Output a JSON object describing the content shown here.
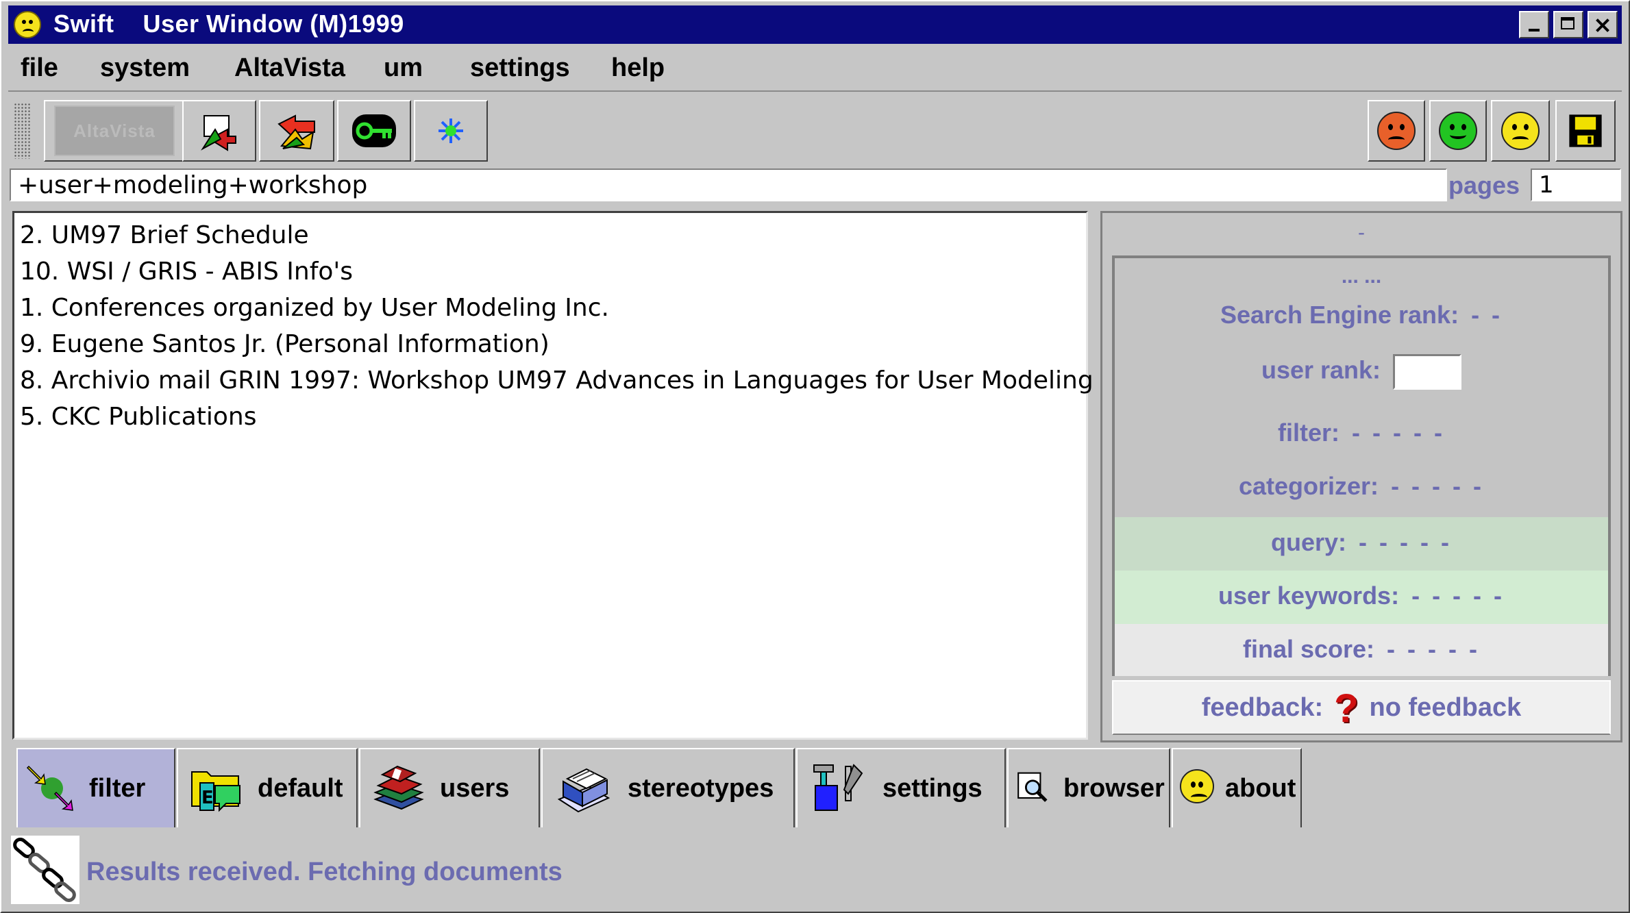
{
  "window": {
    "title": "Swift    User Window (M)1999"
  },
  "menu": [
    "file",
    "system",
    "AltaVista",
    "um",
    "settings",
    "help"
  ],
  "toolbar": {
    "search_engine_logo": "AltaVista",
    "buttons": [
      "go-icon",
      "search-icon",
      "key-icon",
      "sparkle-icon"
    ],
    "feedback_buttons": [
      "angry-face-icon",
      "smile-face-icon",
      "frown-face-icon",
      "save-icon"
    ]
  },
  "query": {
    "value": "+user+modeling+workshop"
  },
  "pages": {
    "label": "pages",
    "value": "1"
  },
  "results": [
    "2. UM97 Brief Schedule",
    "10. WSI / GRIS - ABIS Info's",
    "1. Conferences organized by User Modeling Inc.",
    "9. Eugene Santos Jr. (Personal Information)",
    "8. Archivio mail GRIN 1997: Workshop UM97 Advances in Languages for User Modeling",
    "5. CKC Publications"
  ],
  "info": {
    "top_dash": "-",
    "header": "... ...",
    "search_engine_rank_label": "Search Engine rank:",
    "search_engine_rank_value": "- -",
    "user_rank_label": "user rank:",
    "filter_label": "filter:",
    "filter_value": "- - - - -",
    "categorizer_label": "categorizer:",
    "categorizer_value": "- - - - -",
    "query_label": "query:",
    "query_value": "- - - - -",
    "user_keywords_label": "user keywords:",
    "user_keywords_value": "- - - - -",
    "final_score_label": "final score:",
    "final_score_value": "- - - - -",
    "feedback_label": "feedback:",
    "feedback_value": "no feedback"
  },
  "tabs": [
    "filter",
    "default",
    "users",
    "stereotypes",
    "settings",
    "browser",
    "about"
  ],
  "status": {
    "text": "Results received. Fetching documents"
  }
}
